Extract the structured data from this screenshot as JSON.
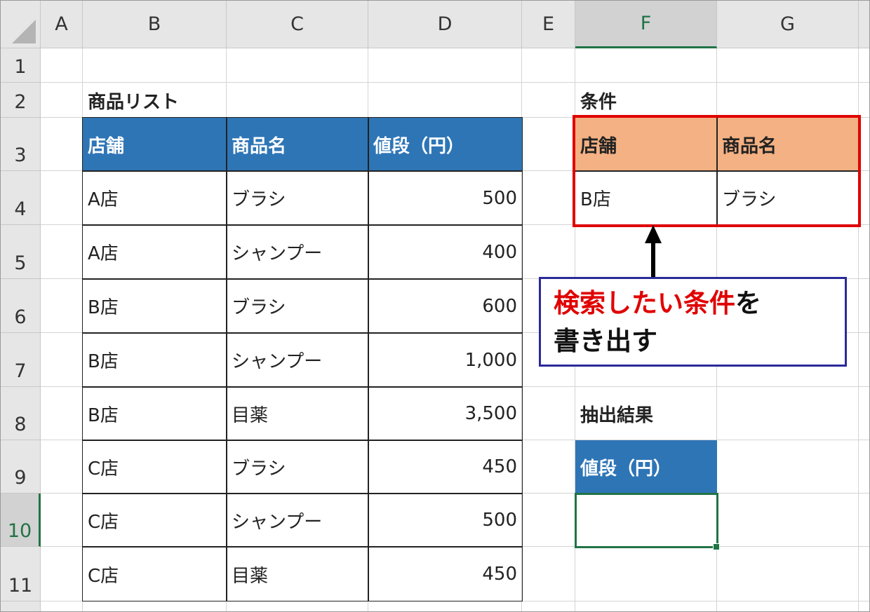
{
  "columns": [
    "A",
    "B",
    "C",
    "D",
    "E",
    "F",
    "G"
  ],
  "rows": [
    "1",
    "2",
    "3",
    "4",
    "5",
    "6",
    "7",
    "8",
    "9",
    "10",
    "11"
  ],
  "product_list": {
    "title": "商品リスト",
    "headers": [
      "店舗",
      "商品名",
      "値段（円）"
    ],
    "rows": [
      [
        "A店",
        "ブラシ",
        "500"
      ],
      [
        "A店",
        "シャンプー",
        "400"
      ],
      [
        "B店",
        "ブラシ",
        "600"
      ],
      [
        "B店",
        "シャンプー",
        "1,000"
      ],
      [
        "B店",
        "目薬",
        "3,500"
      ],
      [
        "C店",
        "ブラシ",
        "450"
      ],
      [
        "C店",
        "シャンプー",
        "500"
      ],
      [
        "C店",
        "目薬",
        "450"
      ]
    ]
  },
  "criteria": {
    "title": "条件",
    "headers": [
      "店舗",
      "商品名"
    ],
    "values": [
      "B店",
      "ブラシ"
    ]
  },
  "result": {
    "title": "抽出結果",
    "header": "値段（円）",
    "value": ""
  },
  "callout": {
    "line1_red": "検索したい条件",
    "line1_black": "を",
    "line2": "書き出す"
  },
  "colors": {
    "header_blue": "#2e75b6",
    "criteria_salmon": "#f4b183",
    "highlight_red": "#e00000",
    "callout_border": "#2a2a9a",
    "selection_green": "#217346"
  }
}
